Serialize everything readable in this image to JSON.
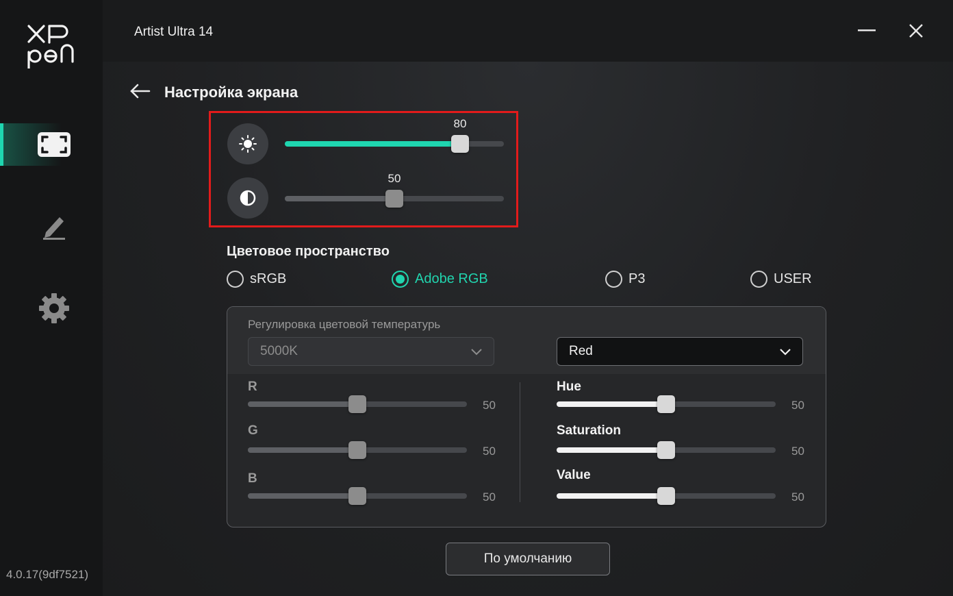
{
  "sidebar": {
    "logo": {
      "line1": "XP",
      "line2": "pen"
    },
    "items": [
      {
        "name": "display",
        "icon": "fullscreen-icon",
        "active": true
      },
      {
        "name": "pen",
        "icon": "pen-icon",
        "active": false
      },
      {
        "name": "settings",
        "icon": "gear-icon",
        "active": false
      }
    ],
    "version": "4.0.17(9df7521)"
  },
  "titlebar": {
    "title": "Artist Ultra 14",
    "minimize_icon": "minimize-icon",
    "close_icon": "close-icon"
  },
  "page": {
    "back_icon": "back-arrow-icon",
    "title": "Настройка экрана"
  },
  "brightness": {
    "icon": "sun-icon",
    "value": 80,
    "value_label": "80",
    "max": 100,
    "accent": "#1fd6b0"
  },
  "contrast": {
    "icon": "contrast-icon",
    "value": 50,
    "value_label": "50",
    "max": 100
  },
  "color_space": {
    "title": "Цветовое пространство",
    "options": [
      {
        "label": "sRGB",
        "checked": false
      },
      {
        "label": "Adobe RGB",
        "checked": true
      },
      {
        "label": "P3",
        "checked": false
      },
      {
        "label": "USER",
        "checked": false
      }
    ],
    "accent": "#21d4ae"
  },
  "color_temp": {
    "label": "Регулировка цветовой температурь",
    "selected": "5000K",
    "disabled": true
  },
  "hsv_channel": {
    "selected": "Red"
  },
  "rgb": [
    {
      "label": "R",
      "value": 50,
      "value_label": "50"
    },
    {
      "label": "G",
      "value": 50,
      "value_label": "50"
    },
    {
      "label": "B",
      "value": 50,
      "value_label": "50"
    }
  ],
  "hsv": [
    {
      "label": "Hue",
      "value": 50,
      "value_label": "50"
    },
    {
      "label": "Saturation",
      "value": 50,
      "value_label": "50"
    },
    {
      "label": "Value",
      "value": 50,
      "value_label": "50"
    }
  ],
  "default_button": "По умолчанию"
}
